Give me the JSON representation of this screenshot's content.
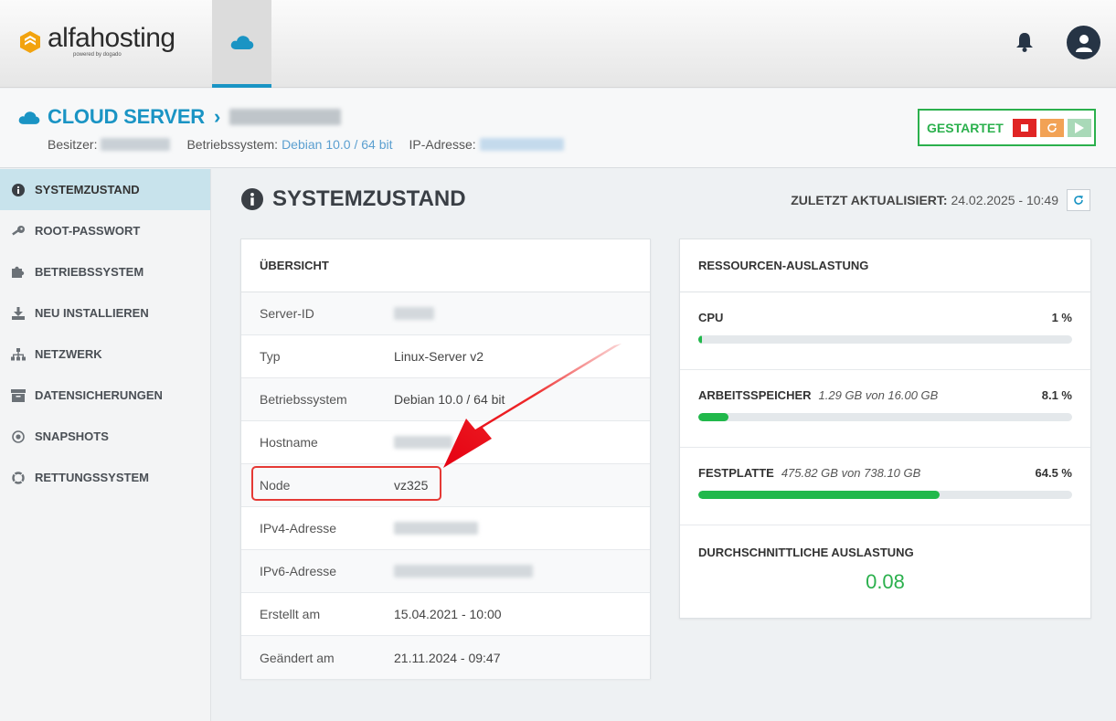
{
  "brand": {
    "name": "alfahosting",
    "tagline": "powered by dogado"
  },
  "server": {
    "title": "CLOUD SERVER",
    "owner_label": "Besitzer:",
    "os_label": "Betriebssystem:",
    "os_value": "Debian 10.0 / 64 bit",
    "ip_label": "IP-Adresse:",
    "status": "GESTARTET"
  },
  "sidebar": {
    "items": [
      {
        "label": "SYSTEMZUSTAND",
        "icon": "info-icon"
      },
      {
        "label": "ROOT-PASSWORT",
        "icon": "key-icon"
      },
      {
        "label": "BETRIEBSSYSTEM",
        "icon": "puzzle-icon"
      },
      {
        "label": "NEU INSTALLIEREN",
        "icon": "download-icon"
      },
      {
        "label": "NETZWERK",
        "icon": "network-icon"
      },
      {
        "label": "DATENSICHERUNGEN",
        "icon": "archive-icon"
      },
      {
        "label": "SNAPSHOTS",
        "icon": "dot-circle-icon"
      },
      {
        "label": "RETTUNGSSYSTEM",
        "icon": "lifebuoy-icon"
      }
    ]
  },
  "main": {
    "title": "SYSTEMZUSTAND",
    "updated_label": "ZULETZT AKTUALISIERT:",
    "updated_value": "24.02.2025 - 10:49"
  },
  "overview": {
    "title": "ÜBERSICHT",
    "rows": [
      {
        "key": "Server-ID",
        "value": ""
      },
      {
        "key": "Typ",
        "value": "Linux-Server v2"
      },
      {
        "key": "Betriebssystem",
        "value": "Debian 10.0 / 64 bit"
      },
      {
        "key": "Hostname",
        "value": ""
      },
      {
        "key": "Node",
        "value": "vz325"
      },
      {
        "key": "IPv4-Adresse",
        "value": ""
      },
      {
        "key": "IPv6-Adresse",
        "value": ""
      },
      {
        "key": "Erstellt am",
        "value": "15.04.2021 - 10:00"
      },
      {
        "key": "Geändert am",
        "value": "21.11.2024 - 09:47"
      }
    ]
  },
  "resources": {
    "title": "RESSOURCEN-AUSLASTUNG",
    "cpu": {
      "label": "CPU",
      "detail": "",
      "percent_text": "1 %",
      "fraction": 0.01
    },
    "ram": {
      "label": "ARBEITSSPEICHER",
      "detail": "1.29 GB von 16.00 GB",
      "percent_text": "8.1 %",
      "fraction": 0.081
    },
    "disk": {
      "label": "FESTPLATTE",
      "detail": "475.82 GB von 738.10 GB",
      "percent_text": "64.5 %",
      "fraction": 0.645
    },
    "avg": {
      "label": "DURCHSCHNITTLICHE AUSLASTUNG",
      "value": "0.08"
    }
  },
  "colors": {
    "accent": "#1a94c4",
    "success": "#2bb04d",
    "danger": "#e02424",
    "warning": "#f2a255"
  }
}
